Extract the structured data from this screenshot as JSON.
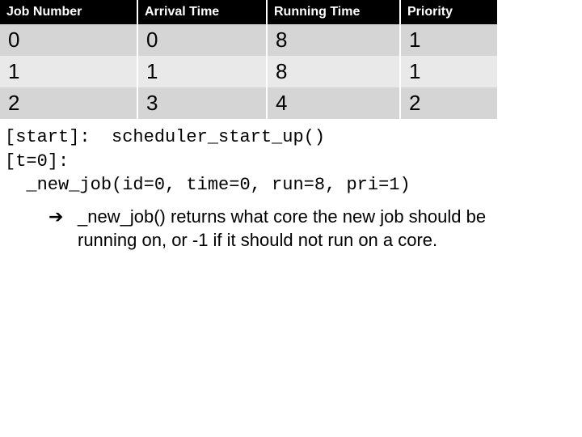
{
  "table": {
    "headers": [
      "Job Number",
      "Arrival Time",
      "Running Time",
      "Priority"
    ],
    "rows": [
      {
        "job": "0",
        "arrival": "0",
        "running": "8",
        "priority": "1"
      },
      {
        "job": "1",
        "arrival": "1",
        "running": "8",
        "priority": "1"
      },
      {
        "job": "2",
        "arrival": "3",
        "running": "4",
        "priority": "2"
      }
    ]
  },
  "log": {
    "line0": "[start]:  scheduler_start_up()",
    "line1": "[t=0]:",
    "line2": "  _new_job(id=0, time=0, run=8, pri=1)"
  },
  "note": {
    "arrow": "➔",
    "text": "_new_job() returns what core the new job should be running on, or -1 if it should not run on a core."
  },
  "chart_data": {
    "type": "table",
    "columns": [
      "Job Number",
      "Arrival Time",
      "Running Time",
      "Priority"
    ],
    "rows": [
      [
        0,
        0,
        8,
        1
      ],
      [
        1,
        1,
        8,
        1
      ],
      [
        2,
        3,
        4,
        2
      ]
    ]
  }
}
